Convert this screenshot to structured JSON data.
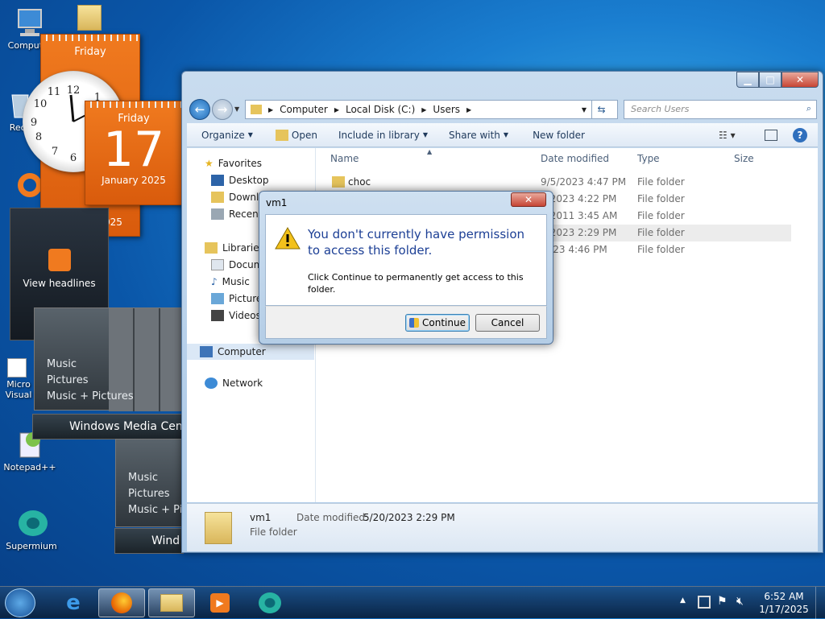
{
  "desktop": {
    "icons": [
      {
        "label": "Computer"
      },
      {
        "label": "Recy"
      },
      {
        "label": "Micro Visual"
      },
      {
        "label": "Notepad++"
      },
      {
        "label": "Supermium"
      }
    ],
    "calendar_back": {
      "day": "Friday",
      "date": "17",
      "month": "January 2025"
    },
    "calendar_front": {
      "day": "Friday",
      "date": "17",
      "month": "January 2025"
    },
    "feed_gadget": {
      "label": "View headlines"
    },
    "media_center_1": {
      "items": [
        "Music",
        "Pictures",
        "Music + Pictures"
      ],
      "title": "Windows Media Cente"
    },
    "media_center_2": {
      "items": [
        "Music",
        "Pictures",
        "Music + Pic"
      ],
      "title": "Wind"
    }
  },
  "explorer": {
    "breadcrumb": [
      "Computer",
      "Local Disk (C:)",
      "Users"
    ],
    "search_placeholder": "Search Users",
    "toolbar": {
      "organize": "Organize",
      "open": "Open",
      "include": "Include in library",
      "share": "Share with",
      "new_folder": "New folder"
    },
    "nav": {
      "favorites": "Favorites",
      "desktop": "Desktop",
      "downloads": "Downlo",
      "recent": "Recent",
      "libraries": "Libraries",
      "documents": "Docum",
      "music": "Music",
      "pictures": "Picture",
      "videos": "Videos",
      "computer": "Computer",
      "network": "Network"
    },
    "columns": {
      "name": "Name",
      "date": "Date modified",
      "type": "Type",
      "size": "Size"
    },
    "rows": [
      {
        "name": "choc",
        "date": "9/5/2023 4:47 PM",
        "type": "File folder"
      },
      {
        "name": "",
        "date": "7/2023 4:22 PM",
        "type": "File folder"
      },
      {
        "name": "",
        "date": "2/2011 3:45 AM",
        "type": "File folder"
      },
      {
        "name": "",
        "date": "0/2023 2:29 PM",
        "type": "File folder"
      },
      {
        "name": "",
        "date": "2023 4:46 PM",
        "type": "File folder"
      }
    ],
    "details": {
      "name": "vm1",
      "date_label": "Date modified:",
      "date_value": "5/20/2023 2:29 PM",
      "type": "File folder"
    }
  },
  "dialog": {
    "title": "vm1",
    "heading": "You don't currently have permission to access this folder.",
    "message": "Click Continue to permanently get access to this folder.",
    "continue_label": "Continue",
    "cancel_label": "Cancel"
  },
  "taskbar": {
    "time": "6:52 AM",
    "date": "1/17/2025"
  }
}
